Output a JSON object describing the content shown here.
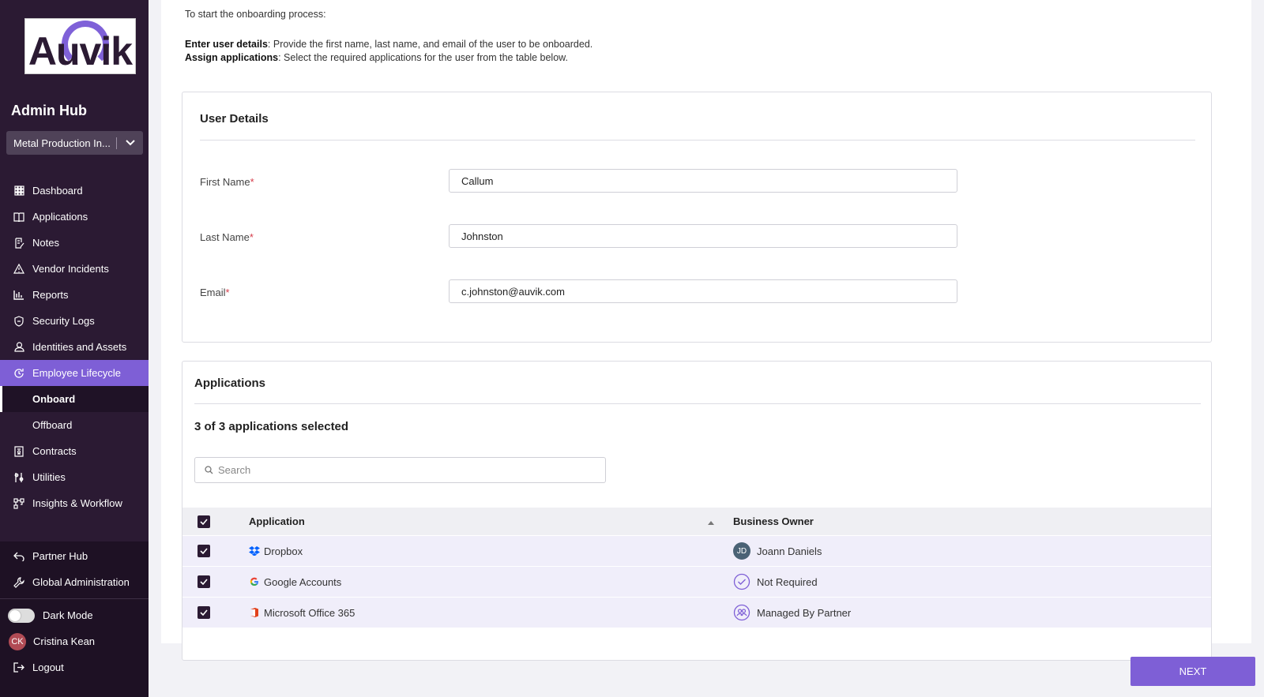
{
  "brand": {
    "logo_text": "Auvik",
    "hub_title": "Admin Hub",
    "accent": "#7e5fd6",
    "sidebar_bg": "#2b1a33"
  },
  "org_selector": {
    "value": "Metal Production In...",
    "icon": "chevron-down-icon"
  },
  "nav": [
    {
      "label": "Dashboard",
      "icon": "grid-icon"
    },
    {
      "label": "Applications",
      "icon": "book-icon"
    },
    {
      "label": "Notes",
      "icon": "notes-icon"
    },
    {
      "label": "Vendor Incidents",
      "icon": "warning-icon"
    },
    {
      "label": "Reports",
      "icon": "chart-icon"
    },
    {
      "label": "Security Logs",
      "icon": "shield-icon"
    },
    {
      "label": "Identities and Assets",
      "icon": "user-icon"
    },
    {
      "label": "Employee Lifecycle",
      "icon": "lifecycle-icon",
      "active": true
    },
    {
      "label": "Onboard",
      "sub": true,
      "current": true
    },
    {
      "label": "Offboard",
      "sub": true
    },
    {
      "label": "Contracts",
      "icon": "contract-icon"
    },
    {
      "label": "Utilities",
      "icon": "utilities-icon"
    },
    {
      "label": "Insights & Workflow",
      "icon": "workflow-icon"
    }
  ],
  "bottom_nav": {
    "partner_hub": "Partner Hub",
    "global_admin": "Global Administration",
    "dark_mode": "Dark Mode",
    "user_initials": "CK",
    "user_name": "Cristina Kean",
    "logout": "Logout"
  },
  "intro": {
    "line1": "To start the onboarding process:",
    "step1_bold": "Enter user details",
    "step1_text": ": Provide the first name, last name, and email of the user to be onboarded.",
    "step2_bold": "Assign applications",
    "step2_text": ": Select the required applications for the user from the table below."
  },
  "user_details": {
    "title": "User Details",
    "required_mark": "*",
    "first_name_label": "First Name",
    "first_name_value": "Callum",
    "last_name_label": "Last Name",
    "last_name_value": "Johnston",
    "email_label": "Email",
    "email_value": "c.johnston@auvik.com"
  },
  "applications": {
    "title": "Applications",
    "selected_text": "3 of 3 applications selected",
    "search_placeholder": "Search",
    "col_application": "Application",
    "col_owner": "Business Owner",
    "rows": [
      {
        "app": "Dropbox",
        "app_icon": "dropbox-icon",
        "owner": "Joann Daniels",
        "owner_initials": "JD",
        "owner_icon": "avatar"
      },
      {
        "app": "Google Accounts",
        "app_icon": "google-icon",
        "owner": "Not Required",
        "owner_icon": "check-circle-icon"
      },
      {
        "app": "Microsoft Office 365",
        "app_icon": "office-icon",
        "owner": "Managed By Partner",
        "owner_icon": "partner-icon"
      }
    ]
  },
  "actions": {
    "next_label": "NEXT"
  }
}
